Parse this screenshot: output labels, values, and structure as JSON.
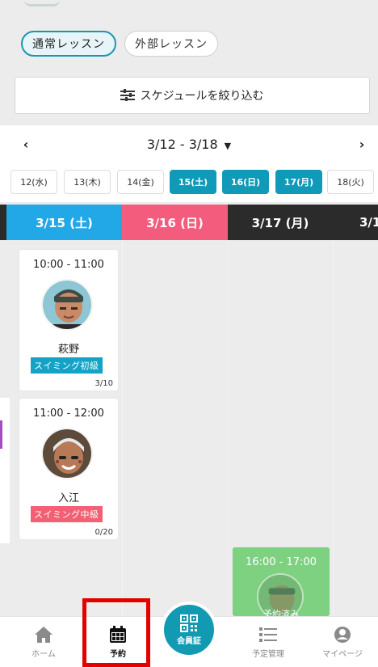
{
  "tabs": [
    {
      "label": "通常レッスン",
      "active": true
    },
    {
      "label": "外部レッスン",
      "active": false
    }
  ],
  "filter": {
    "label": "スケジュールを絞り込む"
  },
  "week": {
    "range": "3/12 - 3/18",
    "caret": "▼",
    "prev": "‹",
    "next": "›"
  },
  "days": [
    {
      "label": "12(水)",
      "selected": false
    },
    {
      "label": "13(木)",
      "selected": false
    },
    {
      "label": "14(金)",
      "selected": false
    },
    {
      "label": "15(土)",
      "selected": true
    },
    {
      "label": "16(日)",
      "selected": true
    },
    {
      "label": "17(月)",
      "selected": true
    },
    {
      "label": "18(火)",
      "selected": false
    }
  ],
  "columns": [
    {
      "label": "3/15 (土)",
      "color": "#22a8e6"
    },
    {
      "label": "3/16 (日)",
      "color": "#f35c7d"
    },
    {
      "label": "3/17 (月)",
      "color": "#2b2b2b"
    },
    {
      "label": "3/1",
      "color": "#2b2b2b"
    }
  ],
  "lessons": [
    {
      "time": "10:00 - 11:00",
      "instructor": "萩野",
      "tag": "スイミング初級",
      "count": "3/10"
    },
    {
      "time": "11:00 - 12:00",
      "instructor": "入江",
      "tag": "スイミング中級",
      "count": "0/20"
    },
    {
      "time": "16:00 - 17:00",
      "status_text": "予約済み"
    }
  ],
  "bottom_nav": [
    {
      "label": "ホーム",
      "icon": "home-icon"
    },
    {
      "label": "予約",
      "icon": "calendar-icon",
      "active": true
    },
    {
      "label": "会員証",
      "icon": "qr-code-icon"
    },
    {
      "label": "予定管理",
      "icon": "list-icon"
    },
    {
      "label": "マイページ",
      "icon": "user-icon"
    }
  ],
  "colors": {
    "accent": "#139ab3",
    "saturday": "#22a8e6",
    "sunday": "#f35c7d",
    "highlight": "#e30000"
  }
}
